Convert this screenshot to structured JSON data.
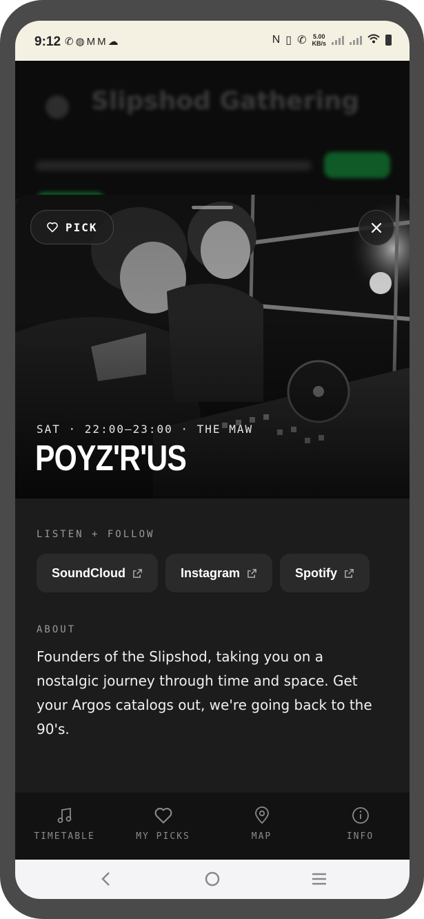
{
  "status_bar": {
    "time": "9:12",
    "notification_icons": [
      "whatsapp-icon",
      "messenger-icon",
      "gmail-icon",
      "gmail-icon",
      "soundcloud-icon"
    ],
    "speed_value": "5.00",
    "speed_unit": "KB/s",
    "battery_level": 0.7
  },
  "background_page": {
    "title": "Slipshod Gathering"
  },
  "hero": {
    "pick_label": "PICK",
    "meta": "SAT · 22:00–23:00 · THE MAW",
    "title": "POYZ'R'US"
  },
  "listen": {
    "label": "LISTEN + FOLLOW",
    "links": [
      {
        "label": "SoundCloud",
        "icon": "external-link-icon"
      },
      {
        "label": "Instagram",
        "icon": "external-link-icon"
      },
      {
        "label": "Spotify",
        "icon": "external-link-icon"
      }
    ]
  },
  "about": {
    "label": "ABOUT",
    "text": "Founders of the Slipshod, taking you on a nostalgic journey through time and space. Get your Argos catalogs out, we're going back to the 90's."
  },
  "tabs": [
    {
      "label": "TIMETABLE",
      "icon": "music-note-icon"
    },
    {
      "label": "MY PICKS",
      "icon": "heart-icon"
    },
    {
      "label": "MAP",
      "icon": "map-pin-icon"
    },
    {
      "label": "INFO",
      "icon": "info-icon"
    }
  ],
  "colors": {
    "sheet_bg": "#1c1c1c",
    "button_bg": "#2a2a2a",
    "tabbar_bg": "#121212",
    "accent_green": "#1a8f3c"
  }
}
